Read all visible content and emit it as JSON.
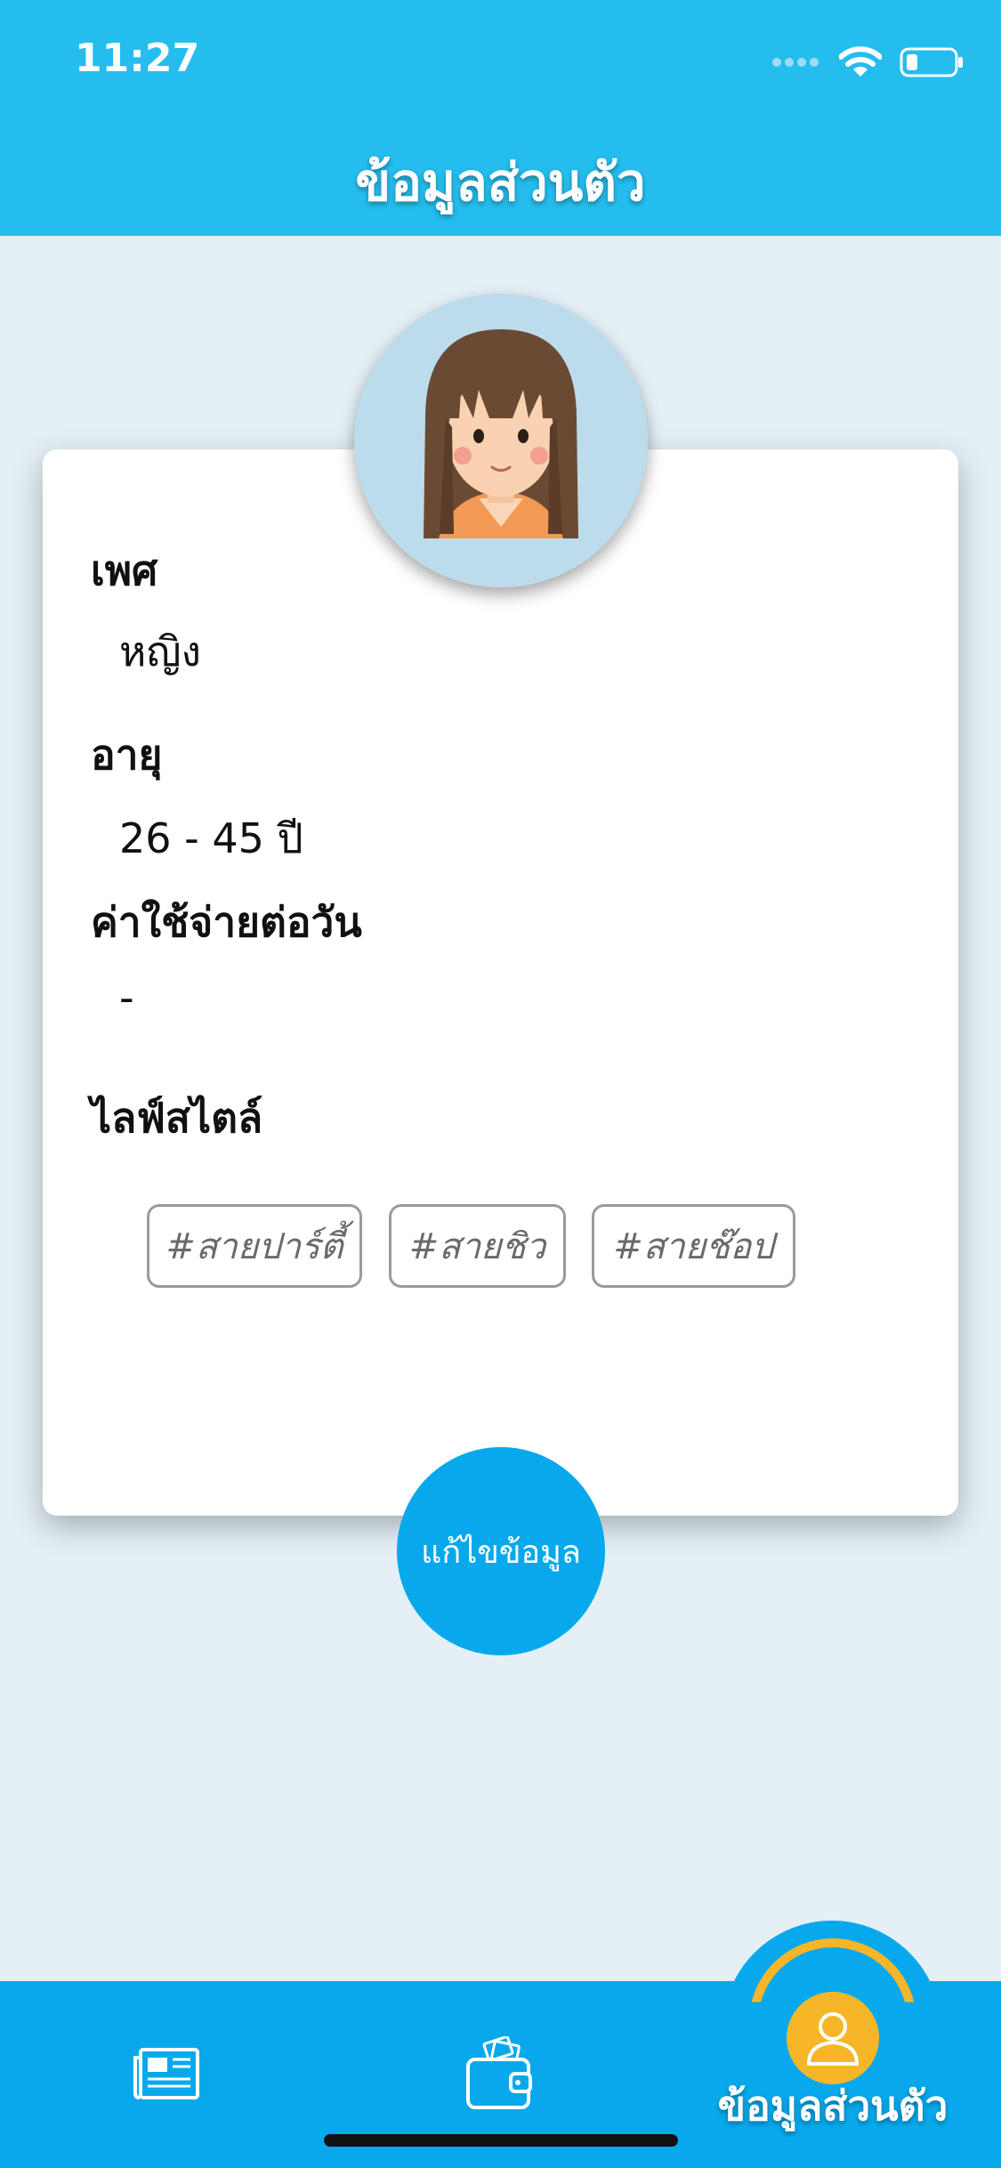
{
  "status": {
    "time": "11:27"
  },
  "header": {
    "title": "ข้อมูลส่วนตัว"
  },
  "profile": {
    "gender_label": "เพศ",
    "gender_value": "หญิง",
    "age_label": "อายุ",
    "age_value": "26 - 45 ปี",
    "expense_label": "ค่าใช้จ่ายต่อวัน",
    "expense_value": "-",
    "lifestyle_label": "ไลฟ์สไตล์",
    "tags": [
      "#สายปาร์ตี้",
      "#สายชิว",
      "#สายช๊อป"
    ]
  },
  "edit_button": {
    "label": "แก้ไขข้อมูล"
  },
  "tabbar": {
    "items": [
      {
        "icon": "newspaper-icon"
      },
      {
        "icon": "wallet-icon"
      },
      {
        "icon": "user-icon",
        "label": "ข้อมูลส่วนตัว",
        "active": true
      }
    ]
  },
  "colors": {
    "header": "#25bdee",
    "background": "#e4f0f6",
    "tabbar": "#08a9ec",
    "accent": "#f6b627",
    "button": "#08a9ec"
  }
}
